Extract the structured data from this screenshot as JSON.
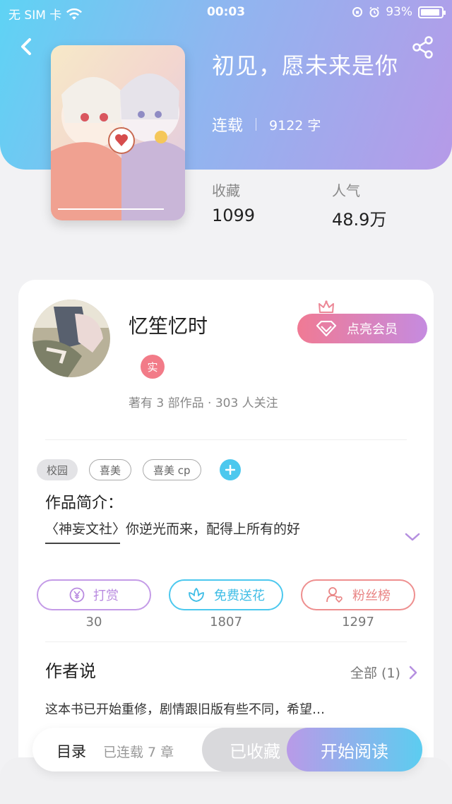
{
  "status_bar": {
    "carrier": "无 SIM 卡",
    "time": "00:03",
    "battery": "93%",
    "battery_level": 0.93
  },
  "book": {
    "title": "初见，愿未来是你",
    "status": "连载",
    "word_count": "9122 字",
    "stats": [
      {
        "label": "收藏",
        "value": "1099"
      },
      {
        "label": "人气",
        "value": "48.9万"
      }
    ]
  },
  "author": {
    "name": "忆笙忆时",
    "badge": "实",
    "summary": "著有 3 部作品 · 303 人关注",
    "vip_label": "点亮会员"
  },
  "tags": [
    "校园",
    "喜美",
    "喜美 cp"
  ],
  "intro": {
    "title": "作品简介：",
    "text": "〈神妄文社〉你逆光而来，配得上所有的好"
  },
  "actions": [
    {
      "label": "打赏",
      "count": "30"
    },
    {
      "label": "免费送花",
      "count": "1807"
    },
    {
      "label": "粉丝榜",
      "count": "1297"
    }
  ],
  "author_say": {
    "title": "作者说",
    "all_label": "全部 (1)",
    "text": "这本书已开始重修，剧情跟旧版有些不同，希望…"
  },
  "bottom_bar": {
    "toc_label": "目录",
    "chapters_label": "已连载 7 章",
    "collect_label": "已收藏",
    "read_label": "开始阅读"
  },
  "colors": {
    "header_gradient_start": "#5ed3f4",
    "header_gradient_end": "#b69ae8",
    "vip_pink": "#f07a94",
    "accent_cyan": "#4cc8ee"
  }
}
